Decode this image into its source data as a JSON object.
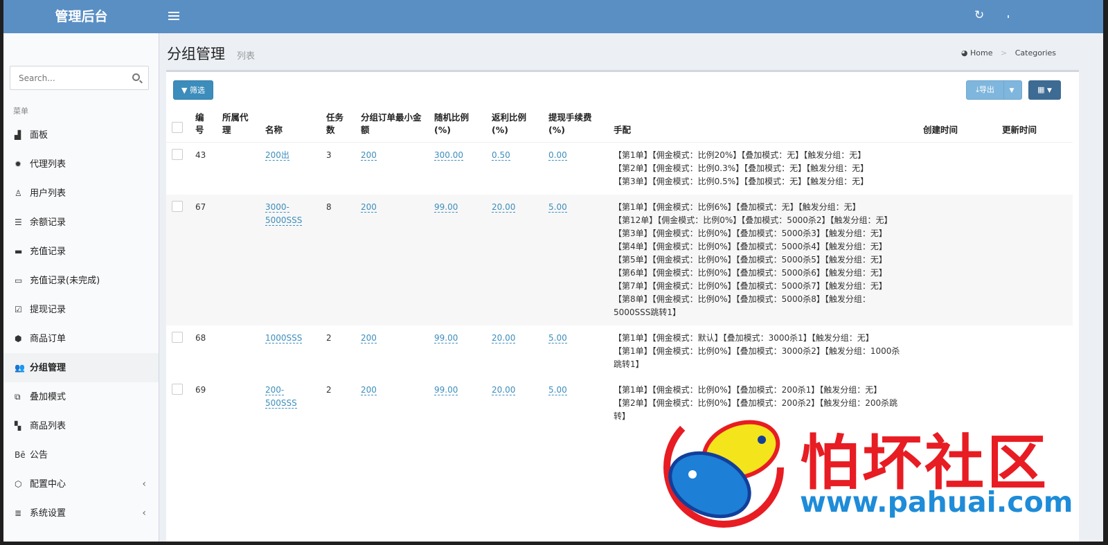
{
  "header": {
    "logo": "管理后台"
  },
  "sidebar": {
    "search_placeholder": "Search...",
    "menu_header": "菜单",
    "items": [
      {
        "label": "面板",
        "icon": "area-chart-icon",
        "glyph": "▟"
      },
      {
        "label": "代理列表",
        "icon": "gear-icon",
        "glyph": "✹"
      },
      {
        "label": "用户列表",
        "icon": "user-icon",
        "glyph": "♙"
      },
      {
        "label": "余额记录",
        "icon": "list-icon",
        "glyph": "☰"
      },
      {
        "label": "充值记录",
        "icon": "battery-icon",
        "glyph": "▬"
      },
      {
        "label": "充值记录(未完成)",
        "icon": "battery-empty-icon",
        "glyph": "▭"
      },
      {
        "label": "提现记录",
        "icon": "check-square-icon",
        "glyph": "☑"
      },
      {
        "label": "商品订单",
        "icon": "cube-icon",
        "glyph": "⬢"
      },
      {
        "label": "分组管理",
        "icon": "users-icon",
        "glyph": "👥"
      },
      {
        "label": "叠加模式",
        "icon": "object-group-icon",
        "glyph": "⧉"
      },
      {
        "label": "商品列表",
        "icon": "wpforms-icon",
        "glyph": "▚"
      },
      {
        "label": "公告",
        "icon": "behance-icon",
        "glyph": "Bē"
      },
      {
        "label": "配置中心",
        "icon": "hexagon-icon",
        "glyph": "⬡"
      },
      {
        "label": "系统设置",
        "icon": "server-icon",
        "glyph": "≣"
      }
    ]
  },
  "page": {
    "title": "分组管理",
    "subtitle": "列表"
  },
  "breadcrumb": {
    "home": "Home",
    "current": "Categories"
  },
  "toolbar": {
    "filter": "筛选",
    "export": "导出"
  },
  "columns": [
    "编号",
    "所属代理",
    "名称",
    "任务数",
    "分组订单最小金额",
    "随机比例(%)",
    "返利比例(%)",
    "提现手续费(%)",
    "手配",
    "创建时间",
    "更新时间"
  ],
  "rows": [
    {
      "id": "43",
      "agent": "",
      "name": "200出",
      "tasks": "3",
      "min": "200",
      "random": "300.00",
      "rebate": "0.50",
      "fee": "0.00",
      "config": [
        "【第1单】【佣金模式：比例20%】【叠加模式：无】【触发分组：无】",
        "【第2单】【佣金模式：比例0.3%】【叠加模式：无】【触发分组：无】",
        "【第3单】【佣金模式：比例0.5%】【叠加模式：无】【触发分组：无】"
      ]
    },
    {
      "id": "67",
      "agent": "",
      "name": "3000-5000SSS",
      "tasks": "8",
      "min": "200",
      "random": "99.00",
      "rebate": "20.00",
      "fee": "5.00",
      "config": [
        "【第1单】【佣金模式：比例6%】【叠加模式：无】【触发分组：无】",
        "【第12单】【佣金模式：比例0%】【叠加模式：5000杀2】【触发分组：无】",
        "【第3单】【佣金模式：比例0%】【叠加模式：5000杀3】【触发分组：无】",
        "【第4单】【佣金模式：比例0%】【叠加模式：5000杀4】【触发分组：无】",
        "【第5单】【佣金模式：比例0%】【叠加模式：5000杀5】【触发分组：无】",
        "【第6单】【佣金模式：比例0%】【叠加模式：5000杀6】【触发分组：无】",
        "【第7单】【佣金模式：比例0%】【叠加模式：5000杀7】【触发分组：无】",
        "【第8单】【佣金模式：比例0%】【叠加模式：5000杀8】【触发分组：5000SSS跳转1】"
      ]
    },
    {
      "id": "68",
      "agent": "",
      "name": "1000SSS",
      "tasks": "2",
      "min": "200",
      "random": "99.00",
      "rebate": "20.00",
      "fee": "5.00",
      "config": [
        "【第1单】【佣金模式：默认】【叠加模式：3000杀1】【触发分组：无】",
        "【第1单】【佣金模式：比例0%】【叠加模式：3000杀2】【触发分组：1000杀跳转1】"
      ]
    },
    {
      "id": "69",
      "agent": "",
      "name": "200-500SSS",
      "tasks": "2",
      "min": "200",
      "random": "99.00",
      "rebate": "20.00",
      "fee": "5.00",
      "config": [
        "【第1单】【佣金模式：比例0%】【叠加模式：200杀1】【触发分组：无】",
        "【第2单】【佣金模式：比例0%】【叠加模式：200杀2】【触发分组：200杀跳转】"
      ]
    }
  ],
  "watermark": {
    "title": "怕坏社区",
    "url": "www.pahuai.com"
  }
}
